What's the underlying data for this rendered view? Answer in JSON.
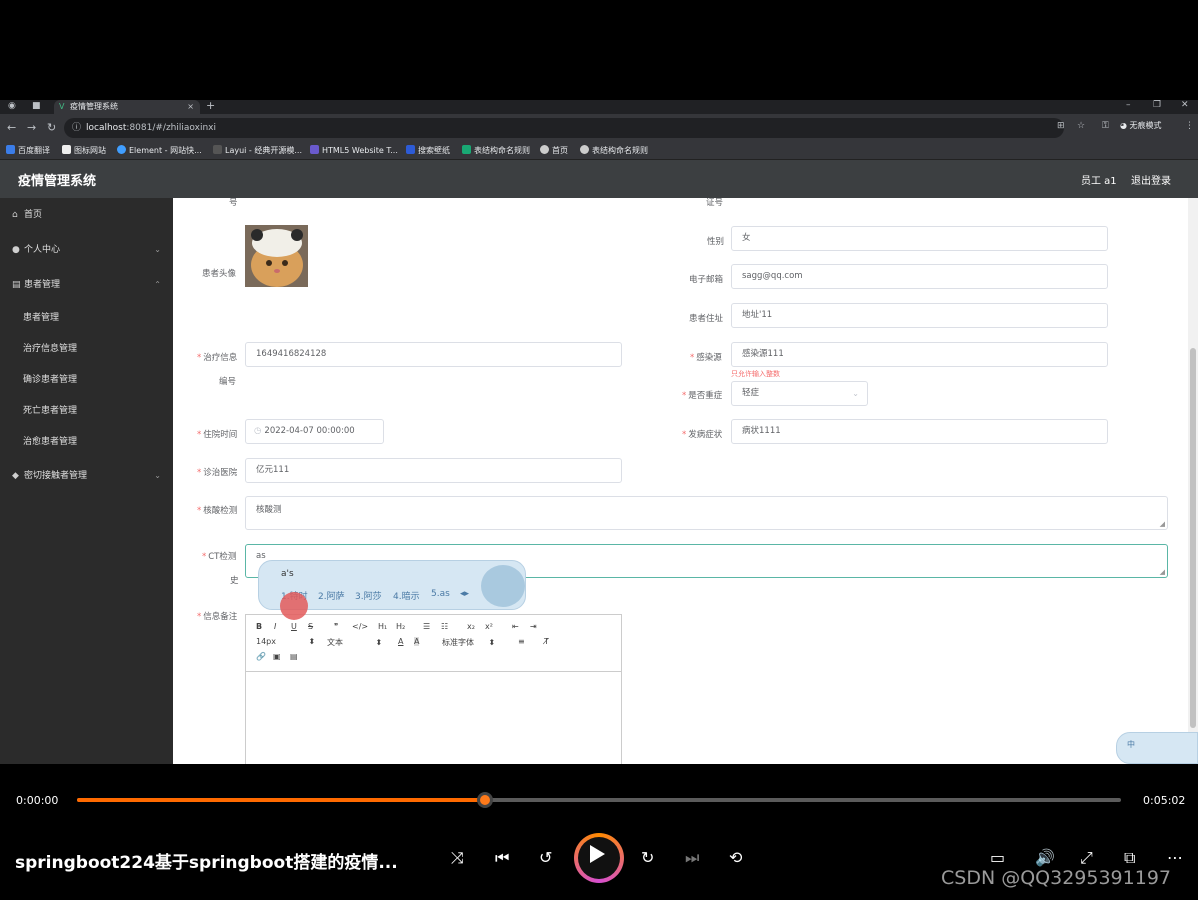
{
  "browser": {
    "tab_title": "疫情管理系统",
    "url_host": "localhost",
    "url_rest": ":8081/#/zhiliaoxinxi",
    "profile_label": "无痕模式",
    "bookmarks": [
      "百度翻译",
      "图标网站",
      "Element - 网站快...",
      "Layui - 经典开源模...",
      "HTML5 Website T...",
      "搜索壁纸",
      "表结构命名规则",
      "首页",
      "表结构命名规则"
    ]
  },
  "app": {
    "title": "疫情管理系统",
    "user": "员工 a1",
    "logout": "退出登录"
  },
  "sidebar": {
    "items": [
      {
        "label": "首页",
        "icon": "home-icon"
      },
      {
        "label": "个人中心",
        "icon": "user-icon"
      },
      {
        "label": "患者管理",
        "icon": "list-icon"
      },
      {
        "label": "密切接触者管理",
        "icon": "location-icon"
      }
    ],
    "sub_items": [
      "患者管理",
      "治疗信息管理",
      "确诊患者管理",
      "死亡患者管理",
      "治愈患者管理"
    ]
  },
  "form": {
    "partial_top_left": "号",
    "partial_top_right": "证号",
    "avatar_label": "患者头像",
    "gender_label": "性别",
    "gender_value": "女",
    "email_label": "电子邮箱",
    "email_value": "sagg@qq.com",
    "address_label": "患者住址",
    "address_value": "地址'11",
    "treatment_no_label_1": "治疗信息",
    "treatment_no_label_2": "编号",
    "treatment_no_value": "1649416824128",
    "source_label": "感染源",
    "source_value": "感染源111",
    "source_error": "只允许输入整数",
    "severe_label": "是否重症",
    "severe_value": "轻症",
    "admit_label": "住院时间",
    "admit_value": "2022-04-07 00:00:00",
    "symptom_label": "发病症状",
    "symptom_value": "病状1111",
    "hospital_label": "诊治医院",
    "hospital_value": "亿元111",
    "nucleic_label": "核酸检测",
    "nucleic_value": "核酸测",
    "ct_label_1": "CT检测",
    "ct_label_2": "史",
    "ct_value": "as",
    "note_label": "信息备注",
    "editor": {
      "font_size": "14px",
      "text_type": "文本",
      "font_family": "标准字体"
    }
  },
  "ime": {
    "composition": "a's",
    "candidates": [
      "1.特时",
      "2.阿萨",
      "3.阿莎",
      "4.暗示",
      "5.as"
    ],
    "mode": "中"
  },
  "player": {
    "current_time": "0:00:00",
    "total_time": "0:05:02",
    "progress": 0.391,
    "title": "springboot224基于springboot搭建的疫情...",
    "watermark": "CSDN @QQ3295391197",
    "accent": "#ff6a00"
  }
}
